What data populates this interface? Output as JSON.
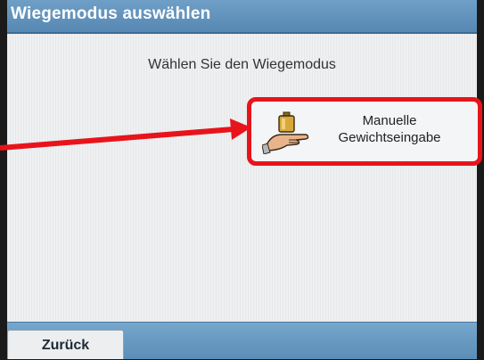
{
  "window": {
    "title": "Wiegemodus auswählen"
  },
  "main": {
    "prompt": "Wählen Sie den Wiegemodus",
    "mode_button": {
      "label_line1": "Manuelle",
      "label_line2": "Gewichtseingabe",
      "icon": "hand-weight-icon",
      "highlight_color": "#e8141b"
    }
  },
  "footer": {
    "back_label": "Zurück"
  },
  "colors": {
    "title_bar": "#5f8fb9",
    "footer_bar": "#6699c0",
    "annotation": "#e8141b"
  }
}
